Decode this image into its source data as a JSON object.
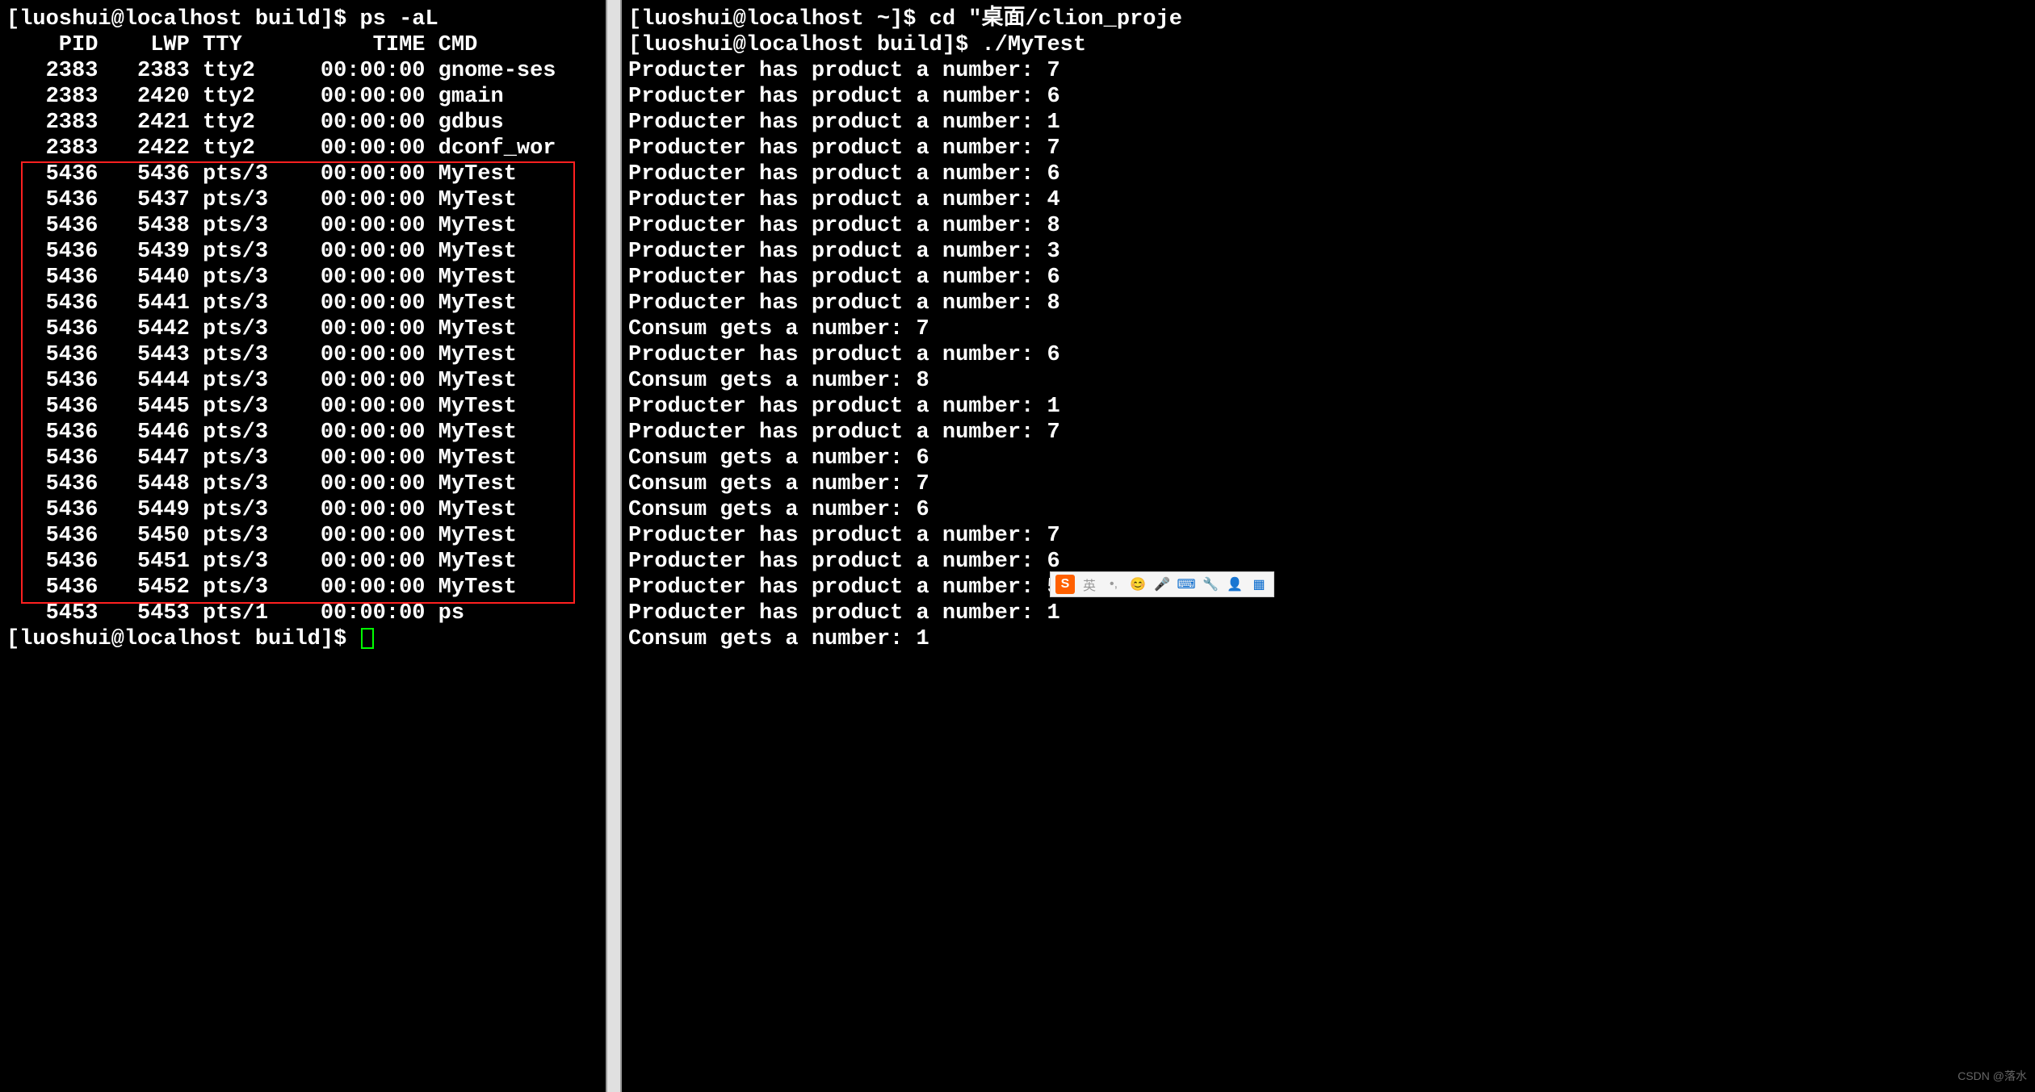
{
  "left": {
    "prompt1": "[luoshui@localhost build]$ ps -aL",
    "header": "    PID    LWP TTY          TIME CMD",
    "rows": [
      "   2383   2383 tty2     00:00:00 gnome-ses",
      "   2383   2420 tty2     00:00:00 gmain",
      "   2383   2421 tty2     00:00:00 gdbus",
      "   2383   2422 tty2     00:00:00 dconf_wor",
      "   5436   5436 pts/3    00:00:00 MyTest",
      "   5436   5437 pts/3    00:00:00 MyTest",
      "   5436   5438 pts/3    00:00:00 MyTest",
      "   5436   5439 pts/3    00:00:00 MyTest",
      "   5436   5440 pts/3    00:00:00 MyTest",
      "   5436   5441 pts/3    00:00:00 MyTest",
      "   5436   5442 pts/3    00:00:00 MyTest",
      "   5436   5443 pts/3    00:00:00 MyTest",
      "   5436   5444 pts/3    00:00:00 MyTest",
      "   5436   5445 pts/3    00:00:00 MyTest",
      "   5436   5446 pts/3    00:00:00 MyTest",
      "   5436   5447 pts/3    00:00:00 MyTest",
      "   5436   5448 pts/3    00:00:00 MyTest",
      "   5436   5449 pts/3    00:00:00 MyTest",
      "   5436   5450 pts/3    00:00:00 MyTest",
      "   5436   5451 pts/3    00:00:00 MyTest",
      "   5436   5452 pts/3    00:00:00 MyTest",
      "   5453   5453 pts/1    00:00:00 ps"
    ],
    "prompt2": "[luoshui@localhost build]$ "
  },
  "right": {
    "prompt1": "[luoshui@localhost ~]$ cd \"桌面/clion_proje",
    "prompt2": "[luoshui@localhost build]$ ./MyTest",
    "lines": [
      "Producter has product a number: 7",
      "Producter has product a number: 6",
      "Producter has product a number: 1",
      "Producter has product a number: 7",
      "Producter has product a number: 6",
      "Producter has product a number: 4",
      "Producter has product a number: 8",
      "Producter has product a number: 3",
      "Producter has product a number: 6",
      "Producter has product a number: 8",
      "Consum gets a number: 7",
      "Producter has product a number: 6",
      "Consum gets a number: 8",
      "Producter has product a number: 1",
      "Producter has product a number: 7",
      "Consum gets a number: 6",
      "Consum gets a number: 7",
      "Consum gets a number: 6",
      "Producter has product a number: 7",
      "Producter has product a number: 6",
      "Producter has product a number: 5",
      "Producter has product a number: 1",
      "Consum gets a number: 1"
    ]
  },
  "ime": {
    "s": "S",
    "lang": "英",
    "dot": "•,",
    "emoji": "😊",
    "mic": "🎤",
    "kbd": "⌨",
    "tool": "🔧",
    "person": "👤",
    "grid": "▦"
  },
  "watermark": "CSDN @落水"
}
